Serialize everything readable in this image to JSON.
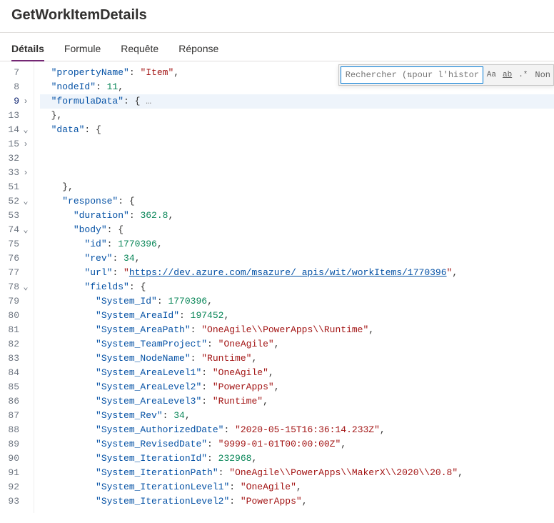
{
  "header": {
    "title": "GetWorkItemDetails"
  },
  "tabs": [
    {
      "label": "Détails",
      "active": true
    },
    {
      "label": "Formule",
      "active": false
    },
    {
      "label": "Requête",
      "active": false
    },
    {
      "label": "Réponse",
      "active": false
    }
  ],
  "search": {
    "placeholder": "Rechercher (⇅pour l'historique)",
    "matchCase": "Aa",
    "wholeWord": "ab",
    "regex": ".*",
    "count": "Non"
  },
  "gutter": [
    {
      "n": 7,
      "fold": ""
    },
    {
      "n": 8,
      "fold": ""
    },
    {
      "n": 9,
      "fold": ">",
      "current": true
    },
    {
      "n": 13,
      "fold": ""
    },
    {
      "n": 14,
      "fold": "v"
    },
    {
      "n": 15,
      "fold": ">"
    },
    {
      "n": 32,
      "fold": ""
    },
    {
      "n": 33,
      "fold": ">"
    },
    {
      "n": 51,
      "fold": ""
    },
    {
      "n": 52,
      "fold": "v"
    },
    {
      "n": 53,
      "fold": ""
    },
    {
      "n": 74,
      "fold": "v"
    },
    {
      "n": 75,
      "fold": ""
    },
    {
      "n": 76,
      "fold": ""
    },
    {
      "n": 77,
      "fold": ""
    },
    {
      "n": 78,
      "fold": "v"
    },
    {
      "n": 79,
      "fold": ""
    },
    {
      "n": 80,
      "fold": ""
    },
    {
      "n": 81,
      "fold": ""
    },
    {
      "n": 82,
      "fold": ""
    },
    {
      "n": 83,
      "fold": ""
    },
    {
      "n": 84,
      "fold": ""
    },
    {
      "n": 85,
      "fold": ""
    },
    {
      "n": 86,
      "fold": ""
    },
    {
      "n": 87,
      "fold": ""
    },
    {
      "n": 88,
      "fold": ""
    },
    {
      "n": 89,
      "fold": ""
    },
    {
      "n": 90,
      "fold": ""
    },
    {
      "n": 91,
      "fold": ""
    },
    {
      "n": 92,
      "fold": ""
    },
    {
      "n": 93,
      "fold": ""
    }
  ],
  "lines": [
    {
      "indent": 1,
      "tokens": [
        {
          "t": "key",
          "v": "\"propertyName\""
        },
        {
          "t": "punc",
          "v": ": "
        },
        {
          "t": "str",
          "v": "\"Item\""
        },
        {
          "t": "punc",
          "v": ","
        }
      ]
    },
    {
      "indent": 1,
      "tokens": [
        {
          "t": "key",
          "v": "\"nodeId\""
        },
        {
          "t": "punc",
          "v": ": "
        },
        {
          "t": "num",
          "v": "11"
        },
        {
          "t": "punc",
          "v": ","
        }
      ]
    },
    {
      "indent": 1,
      "highlight": true,
      "tokens": [
        {
          "t": "key",
          "v": "\"formulaData\""
        },
        {
          "t": "punc",
          "v": ": {"
        },
        {
          "t": "ellipsis",
          "v": " …"
        }
      ]
    },
    {
      "indent": 1,
      "tokens": [
        {
          "t": "punc",
          "v": "},"
        }
      ]
    },
    {
      "indent": 1,
      "tokens": [
        {
          "t": "key",
          "v": "\"data\""
        },
        {
          "t": "punc",
          "v": ": {"
        }
      ]
    },
    {
      "indent": 1,
      "tokens": []
    },
    {
      "indent": 1,
      "tokens": []
    },
    {
      "indent": 1,
      "tokens": []
    },
    {
      "indent": 2,
      "tokens": [
        {
          "t": "punc",
          "v": "},"
        }
      ]
    },
    {
      "indent": 2,
      "tokens": [
        {
          "t": "key",
          "v": "\"response\""
        },
        {
          "t": "punc",
          "v": ": {"
        }
      ]
    },
    {
      "indent": 3,
      "tokens": [
        {
          "t": "key",
          "v": "\"duration\""
        },
        {
          "t": "punc",
          "v": ": "
        },
        {
          "t": "num",
          "v": "362.8"
        },
        {
          "t": "punc",
          "v": ","
        }
      ]
    },
    {
      "indent": 3,
      "tokens": [
        {
          "t": "key",
          "v": "\"body\""
        },
        {
          "t": "punc",
          "v": ": {"
        }
      ]
    },
    {
      "indent": 4,
      "tokens": [
        {
          "t": "key",
          "v": "\"id\""
        },
        {
          "t": "punc",
          "v": ": "
        },
        {
          "t": "num",
          "v": "1770396"
        },
        {
          "t": "punc",
          "v": ","
        }
      ]
    },
    {
      "indent": 4,
      "tokens": [
        {
          "t": "key",
          "v": "\"rev\""
        },
        {
          "t": "punc",
          "v": ": "
        },
        {
          "t": "num",
          "v": "34"
        },
        {
          "t": "punc",
          "v": ","
        }
      ]
    },
    {
      "indent": 4,
      "tokens": [
        {
          "t": "key",
          "v": "\"url\""
        },
        {
          "t": "punc",
          "v": ": "
        },
        {
          "t": "str",
          "v": "\""
        },
        {
          "t": "link",
          "v": "https://dev.azure.com/msazure/_apis/wit/workItems/1770396"
        },
        {
          "t": "str",
          "v": "\""
        },
        {
          "t": "punc",
          "v": ","
        }
      ]
    },
    {
      "indent": 4,
      "tokens": [
        {
          "t": "key",
          "v": "\"fields\""
        },
        {
          "t": "punc",
          "v": ": {"
        }
      ]
    },
    {
      "indent": 5,
      "tokens": [
        {
          "t": "key",
          "v": "\"System_Id\""
        },
        {
          "t": "punc",
          "v": ": "
        },
        {
          "t": "num",
          "v": "1770396"
        },
        {
          "t": "punc",
          "v": ","
        }
      ]
    },
    {
      "indent": 5,
      "tokens": [
        {
          "t": "key",
          "v": "\"System_AreaId\""
        },
        {
          "t": "punc",
          "v": ": "
        },
        {
          "t": "num",
          "v": "197452"
        },
        {
          "t": "punc",
          "v": ","
        }
      ]
    },
    {
      "indent": 5,
      "tokens": [
        {
          "t": "key",
          "v": "\"System_AreaPath\""
        },
        {
          "t": "punc",
          "v": ": "
        },
        {
          "t": "str",
          "v": "\"OneAgile\\\\PowerApps\\\\Runtime\""
        },
        {
          "t": "punc",
          "v": ","
        }
      ]
    },
    {
      "indent": 5,
      "tokens": [
        {
          "t": "key",
          "v": "\"System_TeamProject\""
        },
        {
          "t": "punc",
          "v": ": "
        },
        {
          "t": "str",
          "v": "\"OneAgile\""
        },
        {
          "t": "punc",
          "v": ","
        }
      ]
    },
    {
      "indent": 5,
      "tokens": [
        {
          "t": "key",
          "v": "\"System_NodeName\""
        },
        {
          "t": "punc",
          "v": ": "
        },
        {
          "t": "str",
          "v": "\"Runtime\""
        },
        {
          "t": "punc",
          "v": ","
        }
      ]
    },
    {
      "indent": 5,
      "tokens": [
        {
          "t": "key",
          "v": "\"System_AreaLevel1\""
        },
        {
          "t": "punc",
          "v": ": "
        },
        {
          "t": "str",
          "v": "\"OneAgile\""
        },
        {
          "t": "punc",
          "v": ","
        }
      ]
    },
    {
      "indent": 5,
      "tokens": [
        {
          "t": "key",
          "v": "\"System_AreaLevel2\""
        },
        {
          "t": "punc",
          "v": ": "
        },
        {
          "t": "str",
          "v": "\"PowerApps\""
        },
        {
          "t": "punc",
          "v": ","
        }
      ]
    },
    {
      "indent": 5,
      "tokens": [
        {
          "t": "key",
          "v": "\"System_AreaLevel3\""
        },
        {
          "t": "punc",
          "v": ": "
        },
        {
          "t": "str",
          "v": "\"Runtime\""
        },
        {
          "t": "punc",
          "v": ","
        }
      ]
    },
    {
      "indent": 5,
      "tokens": [
        {
          "t": "key",
          "v": "\"System_Rev\""
        },
        {
          "t": "punc",
          "v": ": "
        },
        {
          "t": "num",
          "v": "34"
        },
        {
          "t": "punc",
          "v": ","
        }
      ]
    },
    {
      "indent": 5,
      "tokens": [
        {
          "t": "key",
          "v": "\"System_AuthorizedDate\""
        },
        {
          "t": "punc",
          "v": ": "
        },
        {
          "t": "str",
          "v": "\"2020-05-15T16:36:14.233Z\""
        },
        {
          "t": "punc",
          "v": ","
        }
      ]
    },
    {
      "indent": 5,
      "tokens": [
        {
          "t": "key",
          "v": "\"System_RevisedDate\""
        },
        {
          "t": "punc",
          "v": ": "
        },
        {
          "t": "str",
          "v": "\"9999-01-01T00:00:00Z\""
        },
        {
          "t": "punc",
          "v": ","
        }
      ]
    },
    {
      "indent": 5,
      "tokens": [
        {
          "t": "key",
          "v": "\"System_IterationId\""
        },
        {
          "t": "punc",
          "v": ": "
        },
        {
          "t": "num",
          "v": "232968"
        },
        {
          "t": "punc",
          "v": ","
        }
      ]
    },
    {
      "indent": 5,
      "tokens": [
        {
          "t": "key",
          "v": "\"System_IterationPath\""
        },
        {
          "t": "punc",
          "v": ": "
        },
        {
          "t": "str",
          "v": "\"OneAgile\\\\PowerApps\\\\MakerX\\\\2020\\\\20.8\""
        },
        {
          "t": "punc",
          "v": ","
        }
      ]
    },
    {
      "indent": 5,
      "tokens": [
        {
          "t": "key",
          "v": "\"System_IterationLevel1\""
        },
        {
          "t": "punc",
          "v": ": "
        },
        {
          "t": "str",
          "v": "\"OneAgile\""
        },
        {
          "t": "punc",
          "v": ","
        }
      ]
    },
    {
      "indent": 5,
      "tokens": [
        {
          "t": "key",
          "v": "\"System_IterationLevel2\""
        },
        {
          "t": "punc",
          "v": ": "
        },
        {
          "t": "str",
          "v": "\"PowerApps\""
        },
        {
          "t": "punc",
          "v": ","
        }
      ]
    }
  ]
}
